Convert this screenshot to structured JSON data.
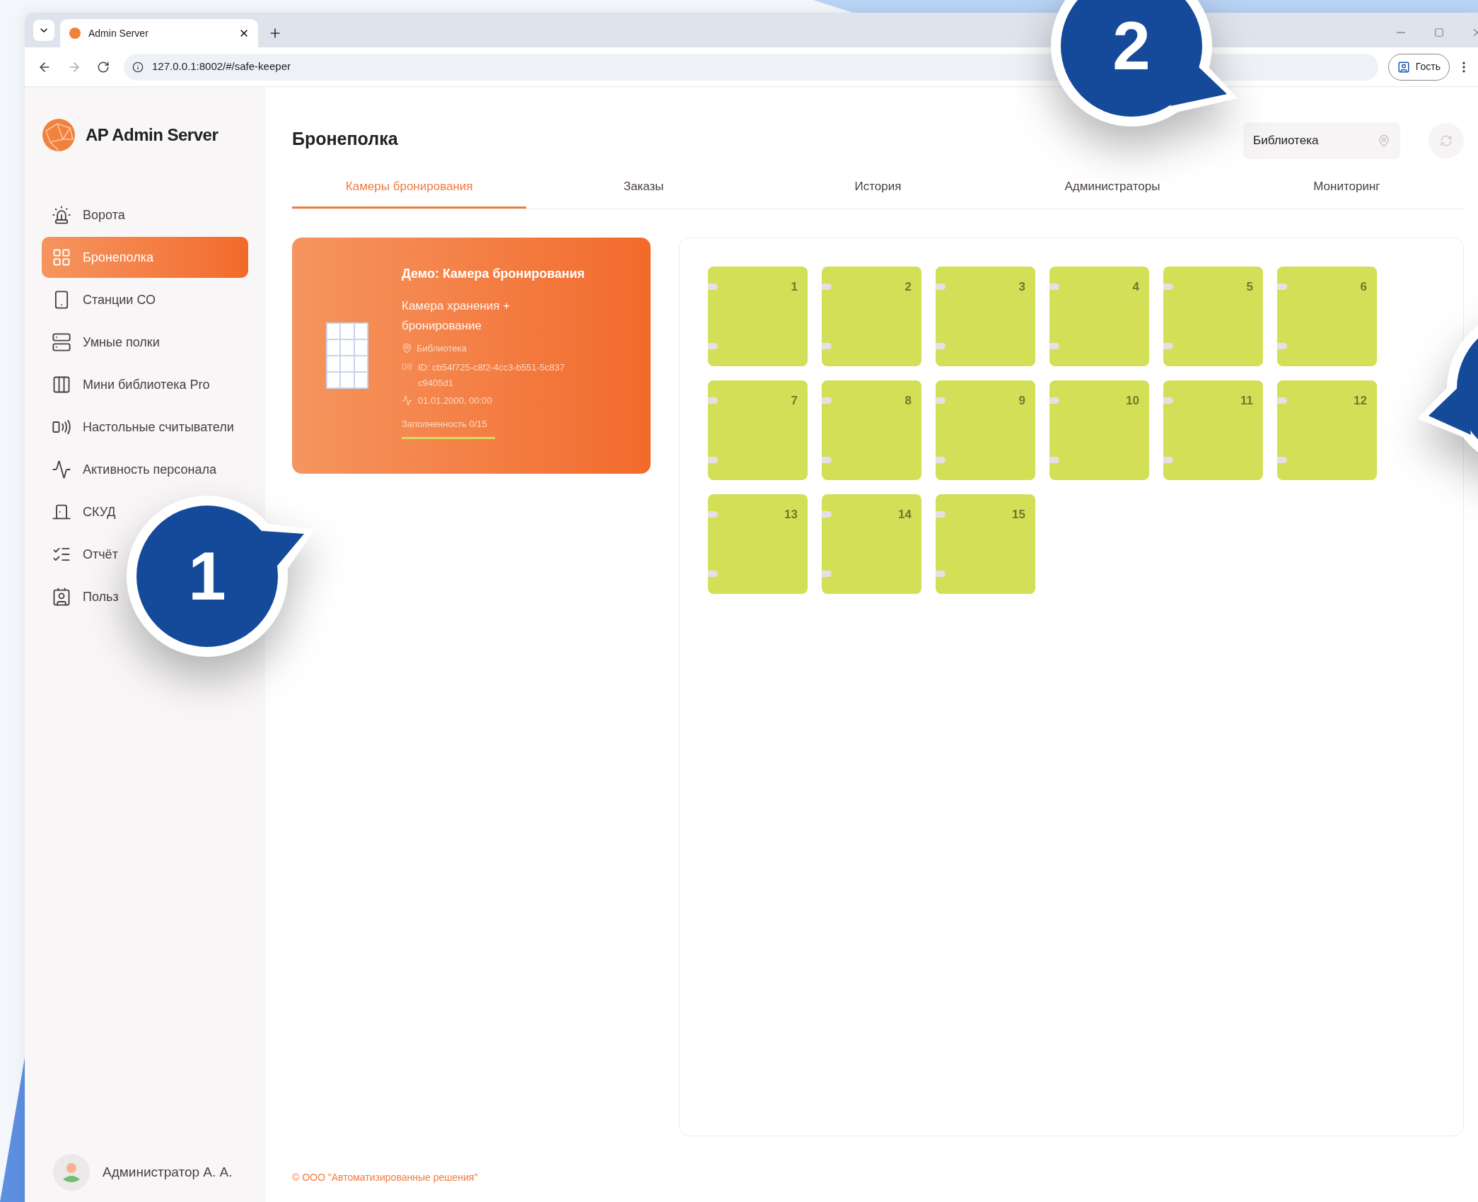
{
  "browser": {
    "tab_title": "Admin Server",
    "url": "127.0.0.1:8002/#/safe-keeper",
    "profile": "Гость"
  },
  "sidebar": {
    "brand": "AP Admin Server",
    "items": [
      {
        "label": "Ворота",
        "selected": false
      },
      {
        "label": "Бронеполка",
        "selected": true
      },
      {
        "label": "Станции СО",
        "selected": false
      },
      {
        "label": "Умные полки",
        "selected": false
      },
      {
        "label": "Мини библиотека Pro",
        "selected": false
      },
      {
        "label": "Настольные считыватели",
        "selected": false
      },
      {
        "label": "Активность персонала",
        "selected": false
      },
      {
        "label": "СКУД",
        "selected": false
      },
      {
        "label": "Отчёт",
        "selected": false
      },
      {
        "label": "Польз",
        "selected": false
      }
    ],
    "user": "Администратор А. А."
  },
  "header": {
    "title": "Бронеполка",
    "location": "Библиотека"
  },
  "tabs": [
    {
      "label": "Камеры бронирования",
      "selected": true
    },
    {
      "label": "Заказы",
      "selected": false
    },
    {
      "label": "История",
      "selected": false
    },
    {
      "label": "Администраторы",
      "selected": false
    },
    {
      "label": "Мониторинг",
      "selected": false
    }
  ],
  "card": {
    "title": "Демо: Камера бронирования",
    "subtitle": "Камера хранения + бронирование",
    "location": "Библиотека",
    "id": "ID: cb54f725-c8f2-4cc3-b551-5c837c9405d1",
    "date": "01.01.2000, 00:00",
    "fill_label": "Заполненность 0/15"
  },
  "cells": [
    {
      "number": "1"
    },
    {
      "number": "2"
    },
    {
      "number": "3"
    },
    {
      "number": "4"
    },
    {
      "number": "5"
    },
    {
      "number": "6"
    },
    {
      "number": "7"
    },
    {
      "number": "8"
    },
    {
      "number": "9"
    },
    {
      "number": "10"
    },
    {
      "number": "11"
    },
    {
      "number": "12"
    },
    {
      "number": "13"
    },
    {
      "number": "14"
    },
    {
      "number": "15"
    }
  ],
  "footer": "© ООО \"Автоматизированные решения\"",
  "callouts": [
    {
      "label": "1"
    },
    {
      "label": "2"
    }
  ]
}
